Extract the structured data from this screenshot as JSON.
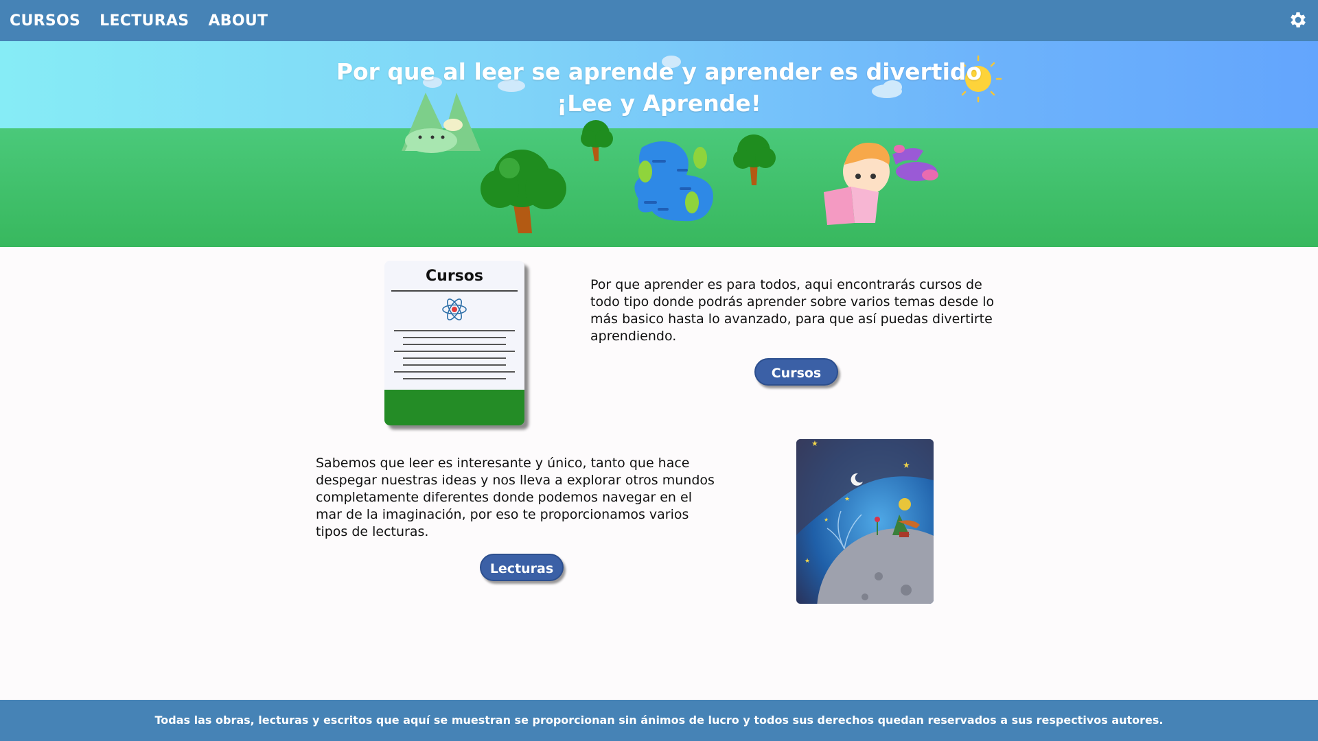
{
  "nav": {
    "items": [
      {
        "label": "CURSOS"
      },
      {
        "label": "LECTURAS"
      },
      {
        "label": "ABOUT"
      }
    ],
    "settings_icon": "gear-icon"
  },
  "hero": {
    "title_line1": "Por que al leer se aprende y aprender es divertido",
    "title_line2": "¡Lee y Aprende!"
  },
  "courses_section": {
    "card_title": "Cursos",
    "card_icon": "atom-icon",
    "description": "Por que aprender es para todos, aqui encontrarás cursos de todo tipo donde podrás aprender sobre varios temas desde lo más basico hasta lo avanzado, para que así puedas divertirte aprendiendo.",
    "button_label": "Cursos"
  },
  "readings_section": {
    "description": "Sabemos que leer es interesante y único, tanto que hace despegar nuestras ideas y nos lleva a explorar otros mundos completamente diferentes donde podemos navegar en el mar de la imaginación, por eso te proporcionamos varios tipos de lecturas.",
    "button_label": "Lecturas"
  },
  "footer": {
    "text": "Todas las obras, lecturas y escritos que aquí se muestran se proporcionan sin ánimos de lucro y todos sus derechos quedan reservados a sus respectivos autores."
  },
  "colors": {
    "nav_bg": "#4683b6",
    "button_bg": "#3b60a6",
    "card_footer": "#248c26"
  }
}
